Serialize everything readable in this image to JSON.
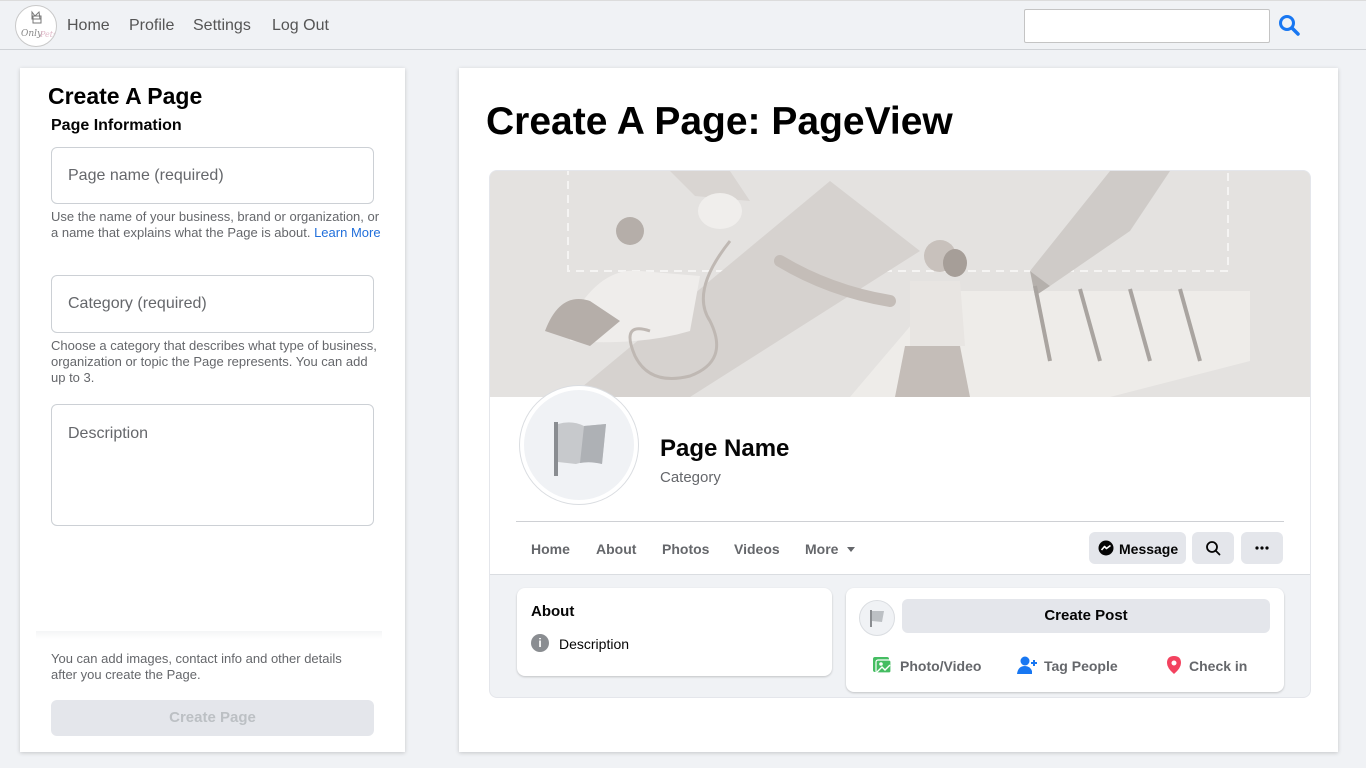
{
  "nav": {
    "logo_text": "OnlyPets",
    "links": [
      "Home",
      "Profile",
      "Settings",
      "Log Out"
    ],
    "search_placeholder": ""
  },
  "form": {
    "title": "Create A Page",
    "section": "Page Information",
    "name_placeholder": "Page name (required)",
    "name_help": "Use the name of your business, brand or organization, or a name that explains what the Page is about.",
    "learn_more": "Learn More",
    "category_placeholder": "Category (required)",
    "category_help": "Choose a category that describes what type of business, organization or topic the Page represents. You can add up to 3.",
    "description_placeholder": "Description",
    "footer_note": "You can add images, contact info and other details after you create the Page.",
    "create_button": "Create Page"
  },
  "preview": {
    "title": "Create A Page: PageView",
    "page_name": "Page Name",
    "category": "Category",
    "tabs": [
      "Home",
      "About",
      "Photos",
      "Videos",
      "More"
    ],
    "message_button": "Message",
    "about_title": "About",
    "about_description": "Description",
    "create_post": "Create Post",
    "actions": [
      "Photo/Video",
      "Tag People",
      "Check in"
    ]
  },
  "colors": {
    "link_blue": "#216fdb",
    "search_icon_blue": "#1877f2",
    "photo_green": "#45bd62",
    "tag_blue": "#1877f2",
    "checkin_red": "#f3425f"
  }
}
